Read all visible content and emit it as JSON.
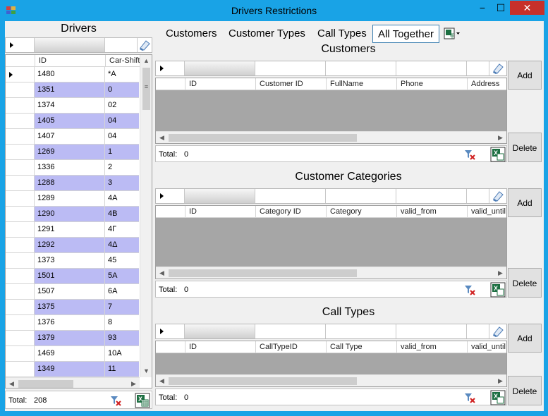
{
  "window": {
    "title": "Drivers Restrictions",
    "minimize_label": "−",
    "maximize_label": "☐",
    "close_label": "✕"
  },
  "drivers": {
    "title": "Drivers",
    "columns": [
      "ID",
      "Car-Shift"
    ],
    "rows": [
      {
        "id": "1480",
        "car_shift": "*A"
      },
      {
        "id": "1351",
        "car_shift": "0"
      },
      {
        "id": "1374",
        "car_shift": "02"
      },
      {
        "id": "1405",
        "car_shift": "04"
      },
      {
        "id": "1407",
        "car_shift": "04"
      },
      {
        "id": "1269",
        "car_shift": "1"
      },
      {
        "id": "1336",
        "car_shift": "2"
      },
      {
        "id": "1288",
        "car_shift": "3"
      },
      {
        "id": "1289",
        "car_shift": "4A"
      },
      {
        "id": "1290",
        "car_shift": "4B"
      },
      {
        "id": "1291",
        "car_shift": "4Γ"
      },
      {
        "id": "1292",
        "car_shift": "4Δ"
      },
      {
        "id": "1373",
        "car_shift": "45"
      },
      {
        "id": "1501",
        "car_shift": "5A"
      },
      {
        "id": "1507",
        "car_shift": "6A"
      },
      {
        "id": "1375",
        "car_shift": "7"
      },
      {
        "id": "1376",
        "car_shift": "8"
      },
      {
        "id": "1379",
        "car_shift": "93"
      },
      {
        "id": "1469",
        "car_shift": "10A"
      },
      {
        "id": "1349",
        "car_shift": "11"
      }
    ],
    "total_label": "Total:",
    "total_value": "208"
  },
  "tabs": [
    {
      "label": "Customers",
      "active": false
    },
    {
      "label": "Customer Types",
      "active": false
    },
    {
      "label": "Call Types",
      "active": false
    },
    {
      "label": "All Together",
      "active": true
    }
  ],
  "sections": [
    {
      "title": "Customers",
      "columns": [
        "ID",
        "Customer ID",
        "FullName",
        "Phone",
        "Address"
      ],
      "total_label": "Total:",
      "total_value": "0",
      "add_label": "Add",
      "delete_label": "Delete"
    },
    {
      "title": "Customer Categories",
      "columns": [
        "ID",
        "Category ID",
        "Category",
        "valid_from",
        "valid_until"
      ],
      "total_label": "Total:",
      "total_value": "0",
      "add_label": "Add",
      "delete_label": "Delete"
    },
    {
      "title": "Call Types",
      "columns": [
        "ID",
        "CallTypeID",
        "Call Type",
        "valid_from",
        "valid_until"
      ],
      "total_label": "Total:",
      "total_value": "0",
      "add_label": "Add",
      "delete_label": "Delete"
    }
  ],
  "colors": {
    "window_frame": "#19a3e6",
    "close_button": "#c7302a",
    "alt_row": "#bbbbf4",
    "empty_grid": "#a6a6a6"
  },
  "icons": {
    "app": "app-icon",
    "clear_filter": "eraser-icon",
    "filter_remove": "filter-remove-icon",
    "excel_export": "excel-icon"
  }
}
